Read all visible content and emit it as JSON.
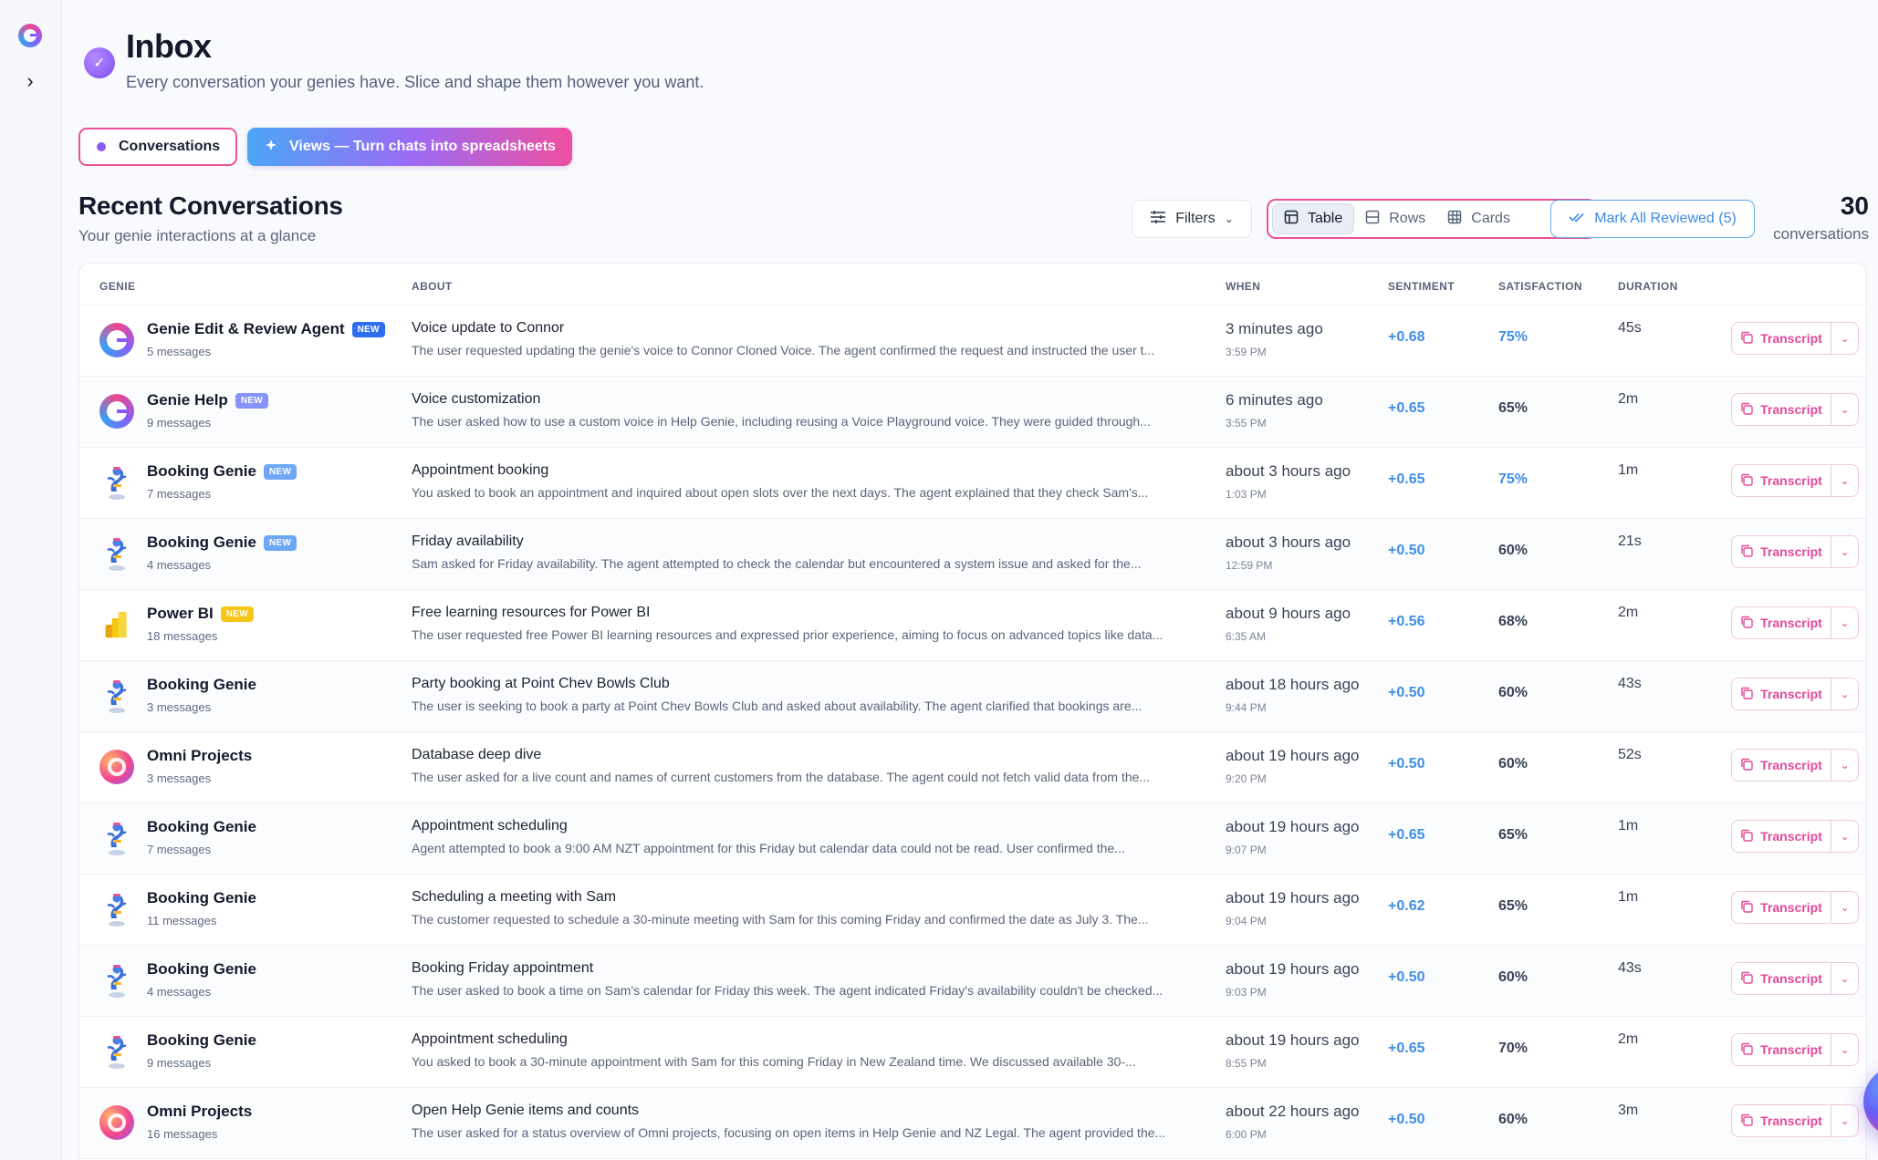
{
  "header": {
    "title": "Inbox",
    "subtitle": "Every conversation your genies have. Slice and shape them however you want."
  },
  "tabs": {
    "conversations": "Conversations",
    "views": "Views — Turn chats into spreadsheets"
  },
  "section": {
    "title": "Recent Conversations",
    "subtitle": "Your genie interactions at a glance"
  },
  "toolbar": {
    "filters": "Filters",
    "view_table": "Table",
    "view_rows": "Rows",
    "view_cards": "Cards",
    "mark_all": "Mark All Reviewed (5)",
    "count": "30",
    "count_label": "conversations"
  },
  "columns": {
    "genie": "GENIE",
    "about": "ABOUT",
    "when": "WHEN",
    "sentiment": "SENTIMENT",
    "satisfaction": "SATISFACTION",
    "duration": "DURATION"
  },
  "transcript_label": "Transcript",
  "colors": {
    "accent_pink": "#e9529a",
    "accent_blue": "#3f8fe8",
    "accent_purple": "#8a5cf6"
  },
  "rows": [
    {
      "genie": "Genie Edit & Review Agent",
      "avatar": "genie-logo",
      "badge": "NEW",
      "badge_style": "b1",
      "messages": "5 messages",
      "title": "Voice update to Connor",
      "summary": "The user requested updating the genie's voice to Connor Cloned Voice. The agent confirmed the request and instructed the user t...",
      "when": "3 minutes ago",
      "time": "3:59 PM",
      "sentiment": "+0.68",
      "satisfaction": "75%",
      "sat_hi": true,
      "duration": "45s"
    },
    {
      "genie": "Genie Help",
      "avatar": "genie-logo",
      "badge": "NEW",
      "badge_style": "b2",
      "messages": "9 messages",
      "title": "Voice customization",
      "summary": "The user asked how to use a custom voice in Help Genie, including reusing a Voice Playground voice. They were guided through...",
      "when": "6 minutes ago",
      "time": "3:55 PM",
      "sentiment": "+0.65",
      "satisfaction": "65%",
      "sat_hi": false,
      "duration": "2m"
    },
    {
      "genie": "Booking Genie",
      "avatar": "booking",
      "badge": "NEW",
      "badge_style": "b3",
      "messages": "7 messages",
      "title": "Appointment booking",
      "summary": "You asked to book an appointment and inquired about open slots over the next days. The agent explained that they check Sam's...",
      "when": "about 3 hours ago",
      "time": "1:03 PM",
      "sentiment": "+0.65",
      "satisfaction": "75%",
      "sat_hi": true,
      "duration": "1m"
    },
    {
      "genie": "Booking Genie",
      "avatar": "booking",
      "badge": "NEW",
      "badge_style": "b3",
      "messages": "4 messages",
      "title": "Friday availability",
      "summary": "Sam asked for Friday availability. The agent attempted to check the calendar but encountered a system issue and asked for the...",
      "when": "about 3 hours ago",
      "time": "12:59 PM",
      "sentiment": "+0.50",
      "satisfaction": "60%",
      "sat_hi": false,
      "duration": "21s"
    },
    {
      "genie": "Power BI",
      "avatar": "powerbi",
      "badge": "NEW",
      "badge_style": "b4",
      "messages": "18 messages",
      "title": "Free learning resources for Power BI",
      "summary": "The user requested free Power BI learning resources and expressed prior experience, aiming to focus on advanced topics like data...",
      "when": "about 9 hours ago",
      "time": "6:35 AM",
      "sentiment": "+0.56",
      "satisfaction": "68%",
      "sat_hi": false,
      "duration": "2m"
    },
    {
      "genie": "Booking Genie",
      "avatar": "booking",
      "badge": "",
      "badge_style": "",
      "messages": "3 messages",
      "title": "Party booking at Point Chev Bowls Club",
      "summary": "The user is seeking to book a party at Point Chev Bowls Club and asked about availability. The agent clarified that bookings are...",
      "when": "about 18 hours ago",
      "time": "9:44 PM",
      "sentiment": "+0.50",
      "satisfaction": "60%",
      "sat_hi": false,
      "duration": "43s"
    },
    {
      "genie": "Omni Projects",
      "avatar": "omni",
      "badge": "",
      "badge_style": "",
      "messages": "3 messages",
      "title": "Database deep dive",
      "summary": "The user asked for a live count and names of current customers from the database. The agent could not fetch valid data from the...",
      "when": "about 19 hours ago",
      "time": "9:20 PM",
      "sentiment": "+0.50",
      "satisfaction": "60%",
      "sat_hi": false,
      "duration": "52s"
    },
    {
      "genie": "Booking Genie",
      "avatar": "booking",
      "badge": "",
      "badge_style": "",
      "messages": "7 messages",
      "title": "Appointment scheduling",
      "summary": "Agent attempted to book a 9:00 AM NZT appointment for this Friday but calendar data could not be read. User confirmed the...",
      "when": "about 19 hours ago",
      "time": "9:07 PM",
      "sentiment": "+0.65",
      "satisfaction": "65%",
      "sat_hi": false,
      "duration": "1m"
    },
    {
      "genie": "Booking Genie",
      "avatar": "booking",
      "badge": "",
      "badge_style": "",
      "messages": "11 messages",
      "title": "Scheduling a meeting with Sam",
      "summary": "The customer requested to schedule a 30-minute meeting with Sam for this coming Friday and confirmed the date as July 3. The...",
      "when": "about 19 hours ago",
      "time": "9:04 PM",
      "sentiment": "+0.62",
      "satisfaction": "65%",
      "sat_hi": false,
      "duration": "1m"
    },
    {
      "genie": "Booking Genie",
      "avatar": "booking",
      "badge": "",
      "badge_style": "",
      "messages": "4 messages",
      "title": "Booking Friday appointment",
      "summary": "The user asked to book a time on Sam's calendar for Friday this week. The agent indicated Friday's availability couldn't be checked...",
      "when": "about 19 hours ago",
      "time": "9:03 PM",
      "sentiment": "+0.50",
      "satisfaction": "60%",
      "sat_hi": false,
      "duration": "43s"
    },
    {
      "genie": "Booking Genie",
      "avatar": "booking",
      "badge": "",
      "badge_style": "",
      "messages": "9 messages",
      "title": "Appointment scheduling",
      "summary": "You asked to book a 30-minute appointment with Sam for this coming Friday in New Zealand time. We discussed available 30-...",
      "when": "about 19 hours ago",
      "time": "8:55 PM",
      "sentiment": "+0.65",
      "satisfaction": "70%",
      "sat_hi": false,
      "duration": "2m"
    },
    {
      "genie": "Omni Projects",
      "avatar": "omni",
      "badge": "",
      "badge_style": "",
      "messages": "16 messages",
      "title": "Open Help Genie items and counts",
      "summary": "The user asked for a status overview of Omni projects, focusing on open items in Help Genie and NZ Legal. The agent provided the...",
      "when": "about 22 hours ago",
      "time": "6:00 PM",
      "sentiment": "+0.50",
      "satisfaction": "60%",
      "sat_hi": false,
      "duration": "3m"
    }
  ]
}
